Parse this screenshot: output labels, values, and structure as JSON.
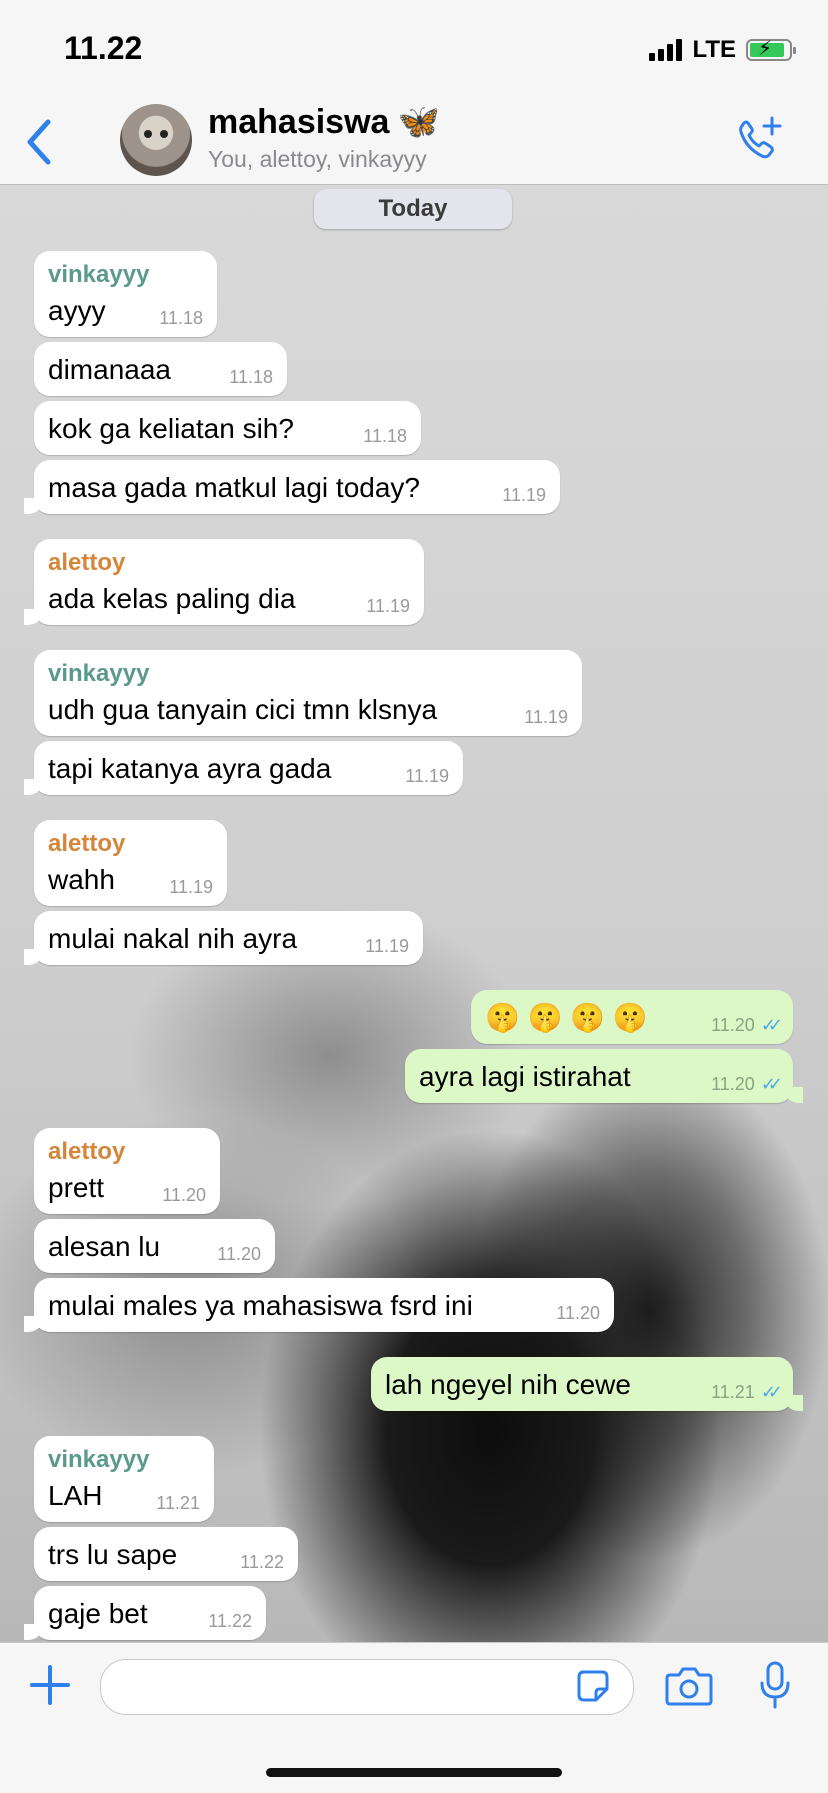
{
  "status": {
    "time": "11.22",
    "network": "LTE"
  },
  "header": {
    "title": "mahasiswa",
    "title_emoji": "🦋",
    "subtitle": "You, alettoy, vinkayyy"
  },
  "date_separator": "Today",
  "colors": {
    "vinkayyy": "#5b9a8b",
    "alettoy": "#d4863a",
    "accent": "#2f80ed"
  },
  "messages": [
    {
      "sender": "vinkayyy",
      "text": "ayyy",
      "time": "11.18"
    },
    {
      "text": "dimanaaa",
      "time": "11.18"
    },
    {
      "text": "kok ga keliatan sih?",
      "time": "11.18"
    },
    {
      "text": "masa gada matkul lagi today?",
      "time": "11.19"
    },
    {
      "sender": "alettoy",
      "text": "ada kelas paling dia",
      "time": "11.19"
    },
    {
      "sender": "vinkayyy",
      "text": "udh gua tanyain cici tmn klsnya",
      "time": "11.19"
    },
    {
      "text": "tapi katanya ayra gada",
      "time": "11.19"
    },
    {
      "sender": "alettoy",
      "text": "wahh",
      "time": "11.19"
    },
    {
      "text": "mulai nakal nih ayra",
      "time": "11.19"
    },
    {
      "text": "🤫 🤫 🤫 🤫",
      "time": "11.20"
    },
    {
      "text": "ayra lagi istirahat",
      "time": "11.20"
    },
    {
      "sender": "alettoy",
      "text": "prett",
      "time": "11.20"
    },
    {
      "text": "alesan lu",
      "time": "11.20"
    },
    {
      "text": "mulai males ya mahasiswa fsrd ini",
      "time": "11.20"
    },
    {
      "text": "lah ngeyel nih cewe",
      "time": "11.21"
    },
    {
      "sender": "vinkayyy",
      "text": "LAH",
      "time": "11.21"
    },
    {
      "text": "trs lu sape",
      "time": "11.22"
    },
    {
      "text": "gaje bet",
      "time": "11.22"
    }
  ],
  "input": {
    "placeholder": ""
  }
}
